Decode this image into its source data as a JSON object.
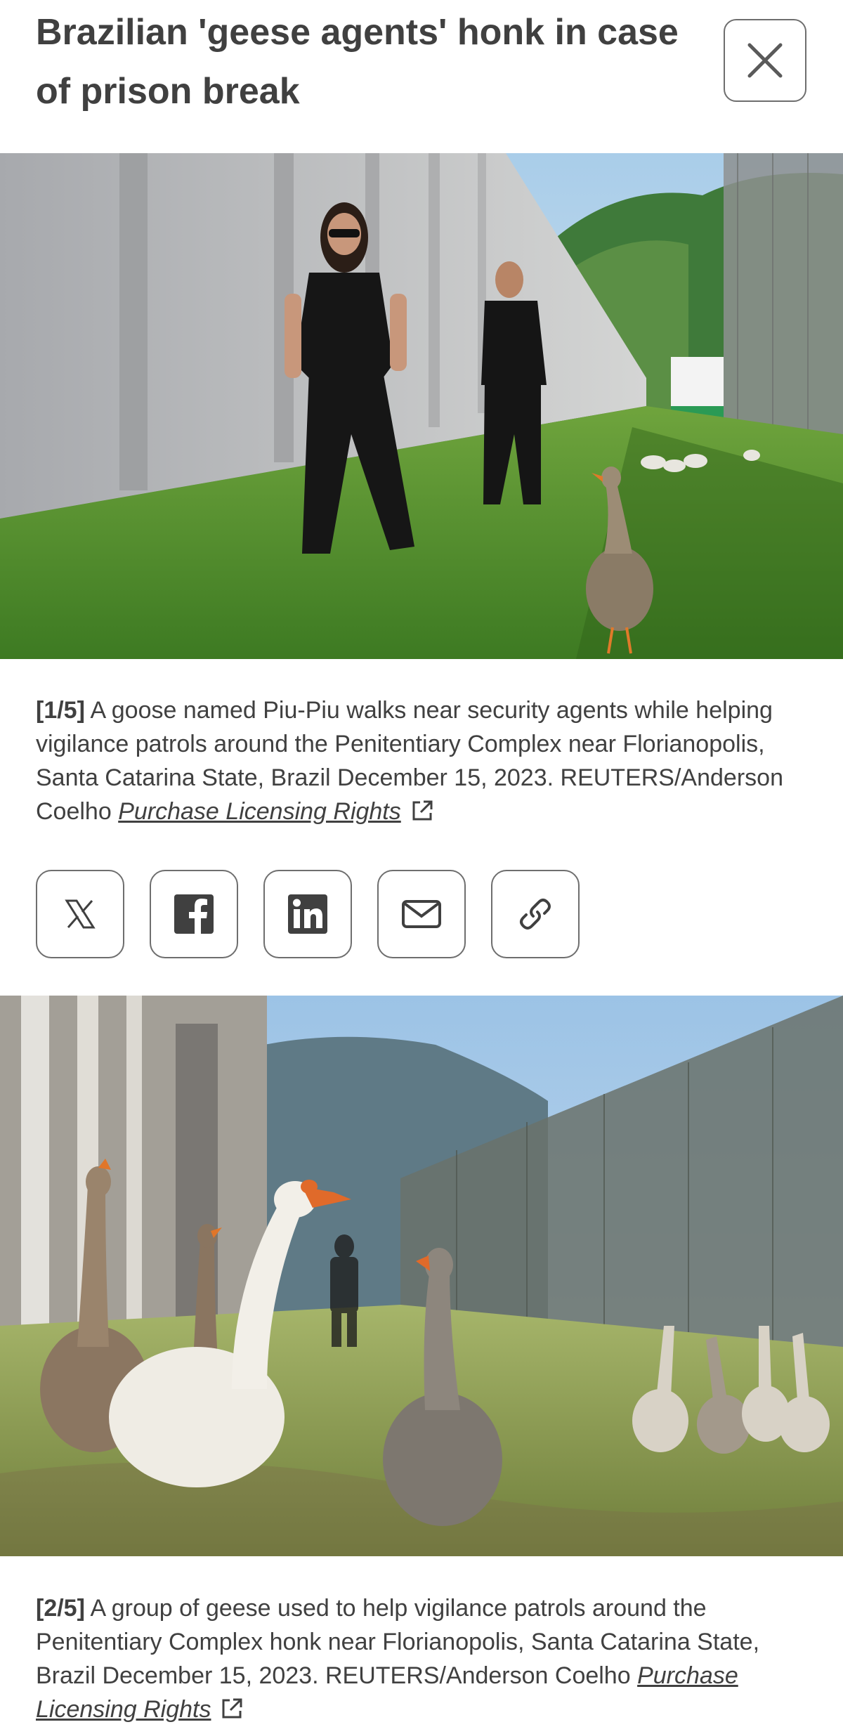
{
  "article": {
    "title": "Brazilian 'geese agents' honk in case of prison break"
  },
  "header": {
    "close_icon": "close-icon"
  },
  "slides": [
    {
      "index_label": "[1/5]",
      "caption": "A goose named Piu-Piu walks near security agents while helping vigilance patrols around the Penitentiary Complex near Florianopolis, Santa Catarina State, Brazil December 15, 2023. REUTERS/Anderson Coelho",
      "licensing_link": "Purchase Licensing Rights",
      "link_icon": "external-link-icon"
    },
    {
      "index_label": "[2/5]",
      "caption": "A group of geese used to help vigilance patrols around the Penitentiary Complex honk near Florianopolis, Santa Catarina State, Brazil December 15, 2023. REUTERS/Anderson Coelho",
      "licensing_link": "Purchase Licensing Rights",
      "link_icon": "external-link-icon"
    }
  ],
  "share": {
    "buttons": [
      {
        "icon": "x-twitter-icon"
      },
      {
        "icon": "facebook-icon"
      },
      {
        "icon": "linkedin-icon"
      },
      {
        "icon": "email-icon"
      },
      {
        "icon": "link-icon"
      }
    ]
  },
  "colors": {
    "text": "#404040",
    "border": "#6e6e6e",
    "grass": "#4f8a2a",
    "sky": "#b8d4ec"
  }
}
